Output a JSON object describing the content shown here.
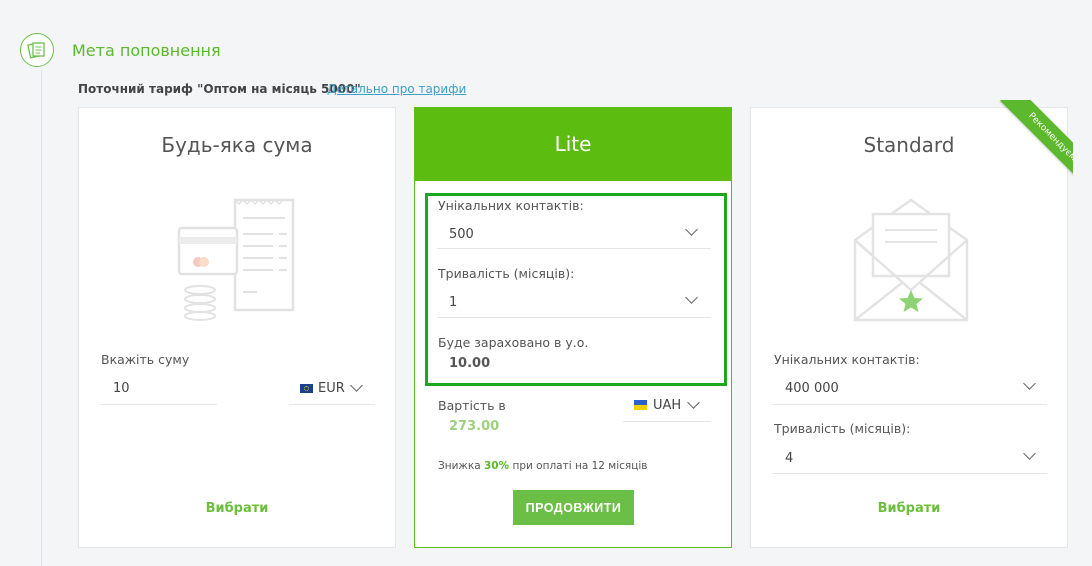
{
  "section": {
    "title": "Мета поповнення",
    "tariff_text": "Поточний тариф \"Оптом на місяць 5000\"",
    "tariff_link": "Детально про тарифи"
  },
  "cards": {
    "any": {
      "title": "Будь-яка сума",
      "amount_label": "Вкажіть суму",
      "amount_value": "10",
      "currency": "EUR",
      "choose": "Вибрати"
    },
    "lite": {
      "title": "Lite",
      "contacts_label": "Унікальних контактів:",
      "contacts_value": "500",
      "duration_label": "Тривалість (місяців):",
      "duration_value": "1",
      "credited_label": "Буде зараховано в у.о.",
      "credited_value": "10.00",
      "cost_label": "Вартість в",
      "cost_value": "273.00",
      "currency": "UAH",
      "discount_prefix": "Знижка ",
      "discount_value": "30%",
      "discount_suffix": " при оплаті на 12 місяців",
      "continue": "ПРОДОВЖИТИ"
    },
    "standard": {
      "title": "Standard",
      "ribbon": "Рекомендуємо",
      "contacts_label": "Унікальних контактів:",
      "contacts_value": "400 000",
      "duration_label": "Тривалість (місяців):",
      "duration_value": "4",
      "choose": "Вибрати"
    }
  },
  "colors": {
    "accent": "#5cbd10",
    "highlight_border": "#1fa81f",
    "link": "#3ca0c8"
  }
}
